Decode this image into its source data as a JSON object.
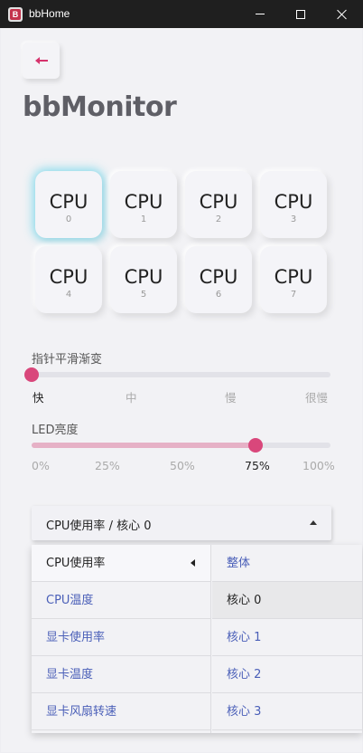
{
  "window": {
    "title": "bbHome",
    "app_icon_letter": "B"
  },
  "page": {
    "title": "bbMonitor",
    "back_button": "arrow-left-icon"
  },
  "cpu_grid": {
    "selected_index": 0,
    "tiles": [
      {
        "label": "CPU",
        "index": "0"
      },
      {
        "label": "CPU",
        "index": "1"
      },
      {
        "label": "CPU",
        "index": "2"
      },
      {
        "label": "CPU",
        "index": "3"
      },
      {
        "label": "CPU",
        "index": "4"
      },
      {
        "label": "CPU",
        "index": "5"
      },
      {
        "label": "CPU",
        "index": "6"
      },
      {
        "label": "CPU",
        "index": "7"
      }
    ]
  },
  "smoothing": {
    "label": "指针平滑渐变",
    "value": 0,
    "options": [
      "快",
      "中",
      "慢",
      "很慢"
    ],
    "selected": "快"
  },
  "brightness": {
    "label": "LED亮度",
    "value_percent": 75,
    "options": [
      "0%",
      "25%",
      "50%",
      "75%",
      "100%"
    ],
    "selected": "75%"
  },
  "dropdown": {
    "value": "CPU使用率 / 核心 0",
    "categories": [
      "CPU使用率",
      "CPU温度",
      "显卡使用率",
      "显卡温度",
      "显卡风扇转速"
    ],
    "current_category": "CPU使用率",
    "sub_options": [
      "整体",
      "核心 0",
      "核心 1",
      "核心 2",
      "核心 3"
    ],
    "current_sub": "核心 0"
  },
  "colors": {
    "accent": "#d9477b",
    "accent_light": "#e6b1c6",
    "selection_glow": "#70d7eb",
    "link_text": "#4a5fb8",
    "titlebar": "#1f1f1f"
  }
}
